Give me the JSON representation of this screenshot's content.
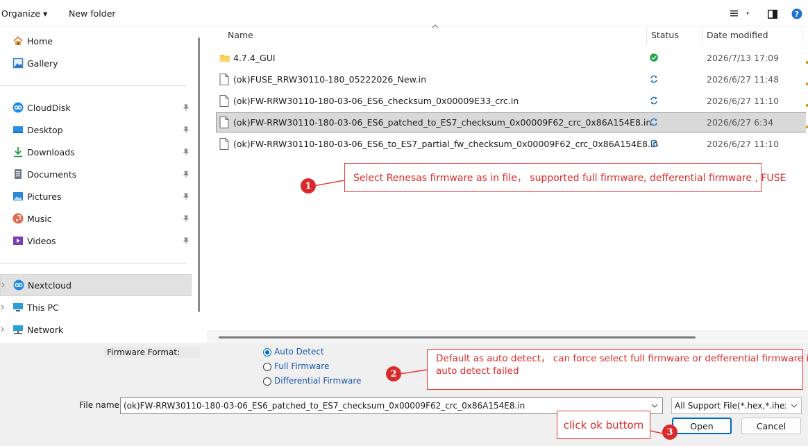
{
  "toolbar": {
    "organize_label": "Organize ▾",
    "new_folder_label": "New folder",
    "icons": [
      "view-list-icon",
      "preview-pane-icon",
      "help-icon"
    ]
  },
  "sidebar": {
    "quick": [
      {
        "label": "Home",
        "icon": "home-icon"
      },
      {
        "label": "Gallery",
        "icon": "gallery-icon"
      }
    ],
    "pinned": [
      {
        "label": "CloudDisk",
        "icon": "cloud-icon"
      },
      {
        "label": "Desktop",
        "icon": "desktop-icon"
      },
      {
        "label": "Downloads",
        "icon": "download-icon"
      },
      {
        "label": "Documents",
        "icon": "document-icon"
      },
      {
        "label": "Pictures",
        "icon": "pictures-icon"
      },
      {
        "label": "Music",
        "icon": "music-icon"
      },
      {
        "label": "Videos",
        "icon": "videos-icon"
      }
    ],
    "tree": [
      {
        "label": "Nextcloud",
        "icon": "nextcloud-icon",
        "selected": true
      },
      {
        "label": "This PC",
        "icon": "pc-icon"
      },
      {
        "label": "Network",
        "icon": "network-icon"
      }
    ]
  },
  "columns": {
    "name": "Name",
    "status": "Status",
    "date": "Date modified"
  },
  "files": [
    {
      "name": "4.7.4_GUI",
      "type": "folder",
      "status": "synced",
      "date": "2026/7/13 17:09"
    },
    {
      "name": "(ok)FUSE_RRW30110-180_05222026_New.in",
      "type": "file",
      "status": "syncing",
      "date": "2026/6/27 11:48"
    },
    {
      "name": "(ok)FW-RRW30110-180-03-06_ES6_checksum_0x00009E33_crc.in",
      "type": "file",
      "status": "syncing",
      "date": "2026/6/27 11:10"
    },
    {
      "name": "(ok)FW-RRW30110-180-03-06_ES6_patched_to_ES7_checksum_0x00009F62_crc_0x86A154E8.in",
      "type": "file",
      "status": "syncing",
      "date": "2026/6/27 6:34",
      "selected": true
    },
    {
      "name": "(ok)FW-RRW30110-180-03-06_ES6_to_ES7_partial_fw_checksum_0x00009F62_crc_0x86A154E8.in",
      "type": "file",
      "status": "syncing",
      "date": "2026/6/27 11:10"
    }
  ],
  "annotations": {
    "a1": {
      "num": "1",
      "text": "Select Renesas firmware as in file， supported full firmware, defferential firmware , FUSE"
    },
    "a2": {
      "num": "2",
      "line1": "Default as auto detect， can force select full firmware or defferential firmware if",
      "line2": "auto detect failed"
    },
    "a3": {
      "num": "3",
      "text": "click ok buttom"
    }
  },
  "format": {
    "label": "Firmware Format:",
    "options": [
      {
        "label": "Auto Detect",
        "checked": true
      },
      {
        "label": "Full Firmware",
        "checked": false
      },
      {
        "label": "Differential Firmware",
        "checked": false
      }
    ]
  },
  "filename": {
    "label": "File name:",
    "value": "(ok)FW-RRW30110-180-03-06_ES6_patched_to_ES7_checksum_0x00009F62_crc_0x86A154E8.in",
    "filter": "All Support File(*.hex,*.ihex,*.bi"
  },
  "buttons": {
    "open": "Open",
    "cancel": "Cancel"
  },
  "colors": {
    "accent": "#0067c0",
    "annotation": "#e02a2a",
    "synced": "#22a54a",
    "syncing": "#1f78c8"
  }
}
